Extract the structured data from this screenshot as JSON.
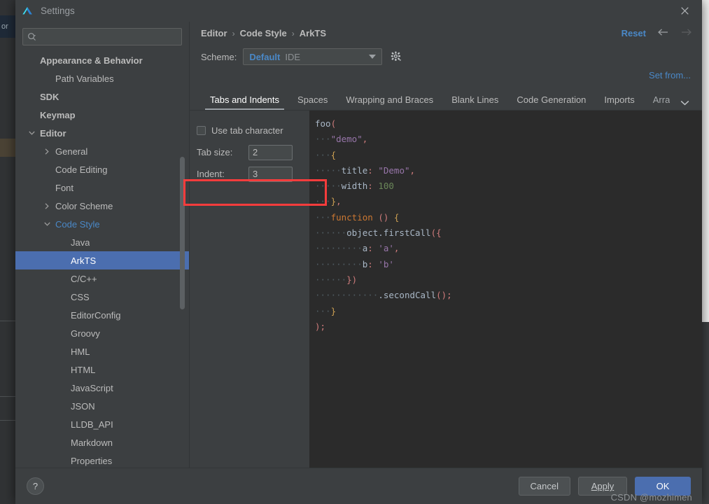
{
  "background": {
    "left_tab_label": "or"
  },
  "window": {
    "title": "Settings",
    "logo_icon": "deveco-logo-icon",
    "close_icon": "close-icon"
  },
  "search": {
    "placeholder": "",
    "value": "",
    "icon": "search-icon"
  },
  "sidebar": {
    "items": [
      {
        "label": "Appearance & Behavior",
        "indent": 0,
        "bold": true,
        "twisty": "none",
        "selected": false,
        "accent": false
      },
      {
        "label": "Path Variables",
        "indent": 1,
        "bold": false,
        "twisty": "none",
        "selected": false,
        "accent": false
      },
      {
        "label": "SDK",
        "indent": 0,
        "bold": true,
        "twisty": "none",
        "selected": false,
        "accent": false
      },
      {
        "label": "Keymap",
        "indent": 0,
        "bold": true,
        "twisty": "none",
        "selected": false,
        "accent": false
      },
      {
        "label": "Editor",
        "indent": 0,
        "bold": true,
        "twisty": "expanded",
        "selected": false,
        "accent": false
      },
      {
        "label": "General",
        "indent": 1,
        "bold": false,
        "twisty": "collapsed",
        "selected": false,
        "accent": false
      },
      {
        "label": "Code Editing",
        "indent": 1,
        "bold": false,
        "twisty": "none",
        "selected": false,
        "accent": false
      },
      {
        "label": "Font",
        "indent": 1,
        "bold": false,
        "twisty": "none",
        "selected": false,
        "accent": false
      },
      {
        "label": "Color Scheme",
        "indent": 1,
        "bold": false,
        "twisty": "collapsed",
        "selected": false,
        "accent": false
      },
      {
        "label": "Code Style",
        "indent": 1,
        "bold": false,
        "twisty": "expanded",
        "selected": false,
        "accent": true
      },
      {
        "label": "Java",
        "indent": 2,
        "bold": false,
        "twisty": "none",
        "selected": false,
        "accent": false
      },
      {
        "label": "ArkTS",
        "indent": 2,
        "bold": false,
        "twisty": "none",
        "selected": true,
        "accent": false
      },
      {
        "label": "C/C++",
        "indent": 2,
        "bold": false,
        "twisty": "none",
        "selected": false,
        "accent": false
      },
      {
        "label": "CSS",
        "indent": 2,
        "bold": false,
        "twisty": "none",
        "selected": false,
        "accent": false
      },
      {
        "label": "EditorConfig",
        "indent": 2,
        "bold": false,
        "twisty": "none",
        "selected": false,
        "accent": false
      },
      {
        "label": "Groovy",
        "indent": 2,
        "bold": false,
        "twisty": "none",
        "selected": false,
        "accent": false
      },
      {
        "label": "HML",
        "indent": 2,
        "bold": false,
        "twisty": "none",
        "selected": false,
        "accent": false
      },
      {
        "label": "HTML",
        "indent": 2,
        "bold": false,
        "twisty": "none",
        "selected": false,
        "accent": false
      },
      {
        "label": "JavaScript",
        "indent": 2,
        "bold": false,
        "twisty": "none",
        "selected": false,
        "accent": false
      },
      {
        "label": "JSON",
        "indent": 2,
        "bold": false,
        "twisty": "none",
        "selected": false,
        "accent": false
      },
      {
        "label": "LLDB_API",
        "indent": 2,
        "bold": false,
        "twisty": "none",
        "selected": false,
        "accent": false
      },
      {
        "label": "Markdown",
        "indent": 2,
        "bold": false,
        "twisty": "none",
        "selected": false,
        "accent": false
      },
      {
        "label": "Properties",
        "indent": 2,
        "bold": false,
        "twisty": "none",
        "selected": false,
        "accent": false
      }
    ]
  },
  "breadcrumb": {
    "items": [
      "Editor",
      "Code Style",
      "ArkTS"
    ],
    "separator": "›",
    "reset_label": "Reset",
    "back_icon": "arrow-left-icon",
    "forward_icon": "arrow-right-icon"
  },
  "scheme": {
    "label": "Scheme:",
    "value": "Default",
    "kind": "IDE",
    "dropdown_icon": "chevron-down-icon",
    "gear_icon": "gear-icon"
  },
  "set_from": {
    "label": "Set from..."
  },
  "tabs": {
    "items": [
      {
        "label": "Tabs and Indents",
        "active": true,
        "clipped": false
      },
      {
        "label": "Spaces",
        "active": false,
        "clipped": false
      },
      {
        "label": "Wrapping and Braces",
        "active": false,
        "clipped": false
      },
      {
        "label": "Blank Lines",
        "active": false,
        "clipped": false
      },
      {
        "label": "Code Generation",
        "active": false,
        "clipped": false
      },
      {
        "label": "Imports",
        "active": false,
        "clipped": false
      },
      {
        "label": "Arra",
        "active": false,
        "clipped": true
      }
    ],
    "more_icon": "chevron-down-icon"
  },
  "options": {
    "use_tab_character": {
      "label": "Use tab character",
      "checked": false
    },
    "tab_size": {
      "label": "Tab size:",
      "value": "2"
    },
    "indent": {
      "label": "Indent:",
      "value": "3"
    }
  },
  "preview": {
    "lines": [
      [
        {
          "t": "foo",
          "c": "k-fn"
        },
        {
          "t": "(",
          "c": "k-paren"
        }
      ],
      [
        {
          "t": "···",
          "c": "ws"
        },
        {
          "t": "\"demo\"",
          "c": "k-str"
        },
        {
          "t": ",",
          "c": "k-paren"
        }
      ],
      [
        {
          "t": "···",
          "c": "ws"
        },
        {
          "t": "{",
          "c": "k-brace"
        }
      ],
      [
        {
          "t": "··",
          "c": "ws"
        },
        {
          "t": "···",
          "c": "ws"
        },
        {
          "t": "title",
          "c": "k-prop"
        },
        {
          "t": ":",
          "c": "k-paren"
        },
        {
          "t": " ",
          "c": "ws"
        },
        {
          "t": "\"Demo\"",
          "c": "k-str"
        },
        {
          "t": ",",
          "c": "k-paren"
        }
      ],
      [
        {
          "t": "··",
          "c": "ws"
        },
        {
          "t": "···",
          "c": "ws"
        },
        {
          "t": "width",
          "c": "k-prop"
        },
        {
          "t": ":",
          "c": "k-paren"
        },
        {
          "t": " ",
          "c": "ws"
        },
        {
          "t": "100",
          "c": "k-num"
        }
      ],
      [
        {
          "t": "···",
          "c": "ws"
        },
        {
          "t": "}",
          "c": "k-brace"
        },
        {
          "t": ",",
          "c": "k-paren"
        }
      ],
      [
        {
          "t": "···",
          "c": "ws"
        },
        {
          "t": "function",
          "c": "k-kw"
        },
        {
          "t": " ",
          "c": "ws"
        },
        {
          "t": "()",
          "c": "k-paren"
        },
        {
          "t": " ",
          "c": "ws"
        },
        {
          "t": "{",
          "c": "k-brace"
        }
      ],
      [
        {
          "t": "······",
          "c": "ws"
        },
        {
          "t": "object.firstCall",
          "c": "k-meth"
        },
        {
          "t": "({",
          "c": "k-paren"
        }
      ],
      [
        {
          "t": "·········",
          "c": "ws"
        },
        {
          "t": "a",
          "c": "k-prop"
        },
        {
          "t": ":",
          "c": "k-paren"
        },
        {
          "t": " ",
          "c": "ws"
        },
        {
          "t": "'a'",
          "c": "k-str"
        },
        {
          "t": ",",
          "c": "k-paren"
        }
      ],
      [
        {
          "t": "·········",
          "c": "ws"
        },
        {
          "t": "b",
          "c": "k-prop"
        },
        {
          "t": ":",
          "c": "k-paren"
        },
        {
          "t": " ",
          "c": "ws"
        },
        {
          "t": "'b'",
          "c": "k-str"
        }
      ],
      [
        {
          "t": "······",
          "c": "ws"
        },
        {
          "t": "})",
          "c": "k-paren"
        }
      ],
      [
        {
          "t": "············",
          "c": "ws"
        },
        {
          "t": ".secondCall",
          "c": "k-meth"
        },
        {
          "t": "();",
          "c": "k-paren"
        }
      ],
      [
        {
          "t": "···",
          "c": "ws"
        },
        {
          "t": "}",
          "c": "k-brace"
        }
      ],
      [
        {
          "t": ");",
          "c": "k-paren"
        }
      ]
    ],
    "text": "foo(\n···\"demo\",\n···{\n·····title: \"Demo\",\n·····width: 100\n···},\n···function () {\n······object.firstCall({\n·········a: 'a',\n·········b: 'b'\n······})\n············.secondCall();\n···}\n);"
  },
  "annotations": [
    {
      "name": "indent-row-highlight",
      "color": "#fa3c3c"
    }
  ],
  "footer": {
    "help_icon": "help-icon",
    "cancel_label": "Cancel",
    "apply_label": "Apply",
    "apply_mnemonic": "A",
    "ok_label": "OK"
  },
  "watermark": {
    "text": "CSDN @mozhimen"
  },
  "colors": {
    "accent_blue": "#4a88c7",
    "selection_blue": "#4b6eaf",
    "panel_bg": "#3c3f41",
    "editor_bg": "#2b2b2b",
    "annotation_red": "#fa3c3c"
  }
}
